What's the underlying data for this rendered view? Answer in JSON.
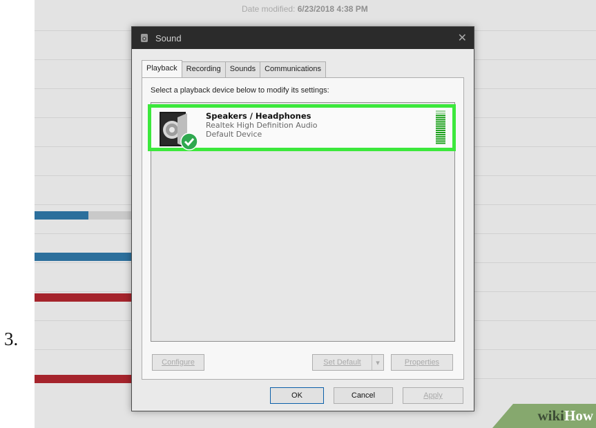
{
  "step": {
    "number": "3."
  },
  "background": {
    "date_label": "Date modified:",
    "date_value": "6/23/2018 4:38 PM"
  },
  "dialog": {
    "title": "Sound",
    "close_glyph": "✕",
    "tabs": [
      {
        "label": "Playback",
        "active": true
      },
      {
        "label": "Recording",
        "active": false
      },
      {
        "label": "Sounds",
        "active": false
      },
      {
        "label": "Communications",
        "active": false
      }
    ],
    "instruction": "Select a playback device below to modify its settings:",
    "devices": [
      {
        "name": "Speakers / Headphones",
        "driver": "Realtek High Definition Audio",
        "status": "Default Device",
        "icon": "speaker-icon",
        "badge_icon": "default-check-icon",
        "selected": true
      }
    ],
    "buttons": {
      "configure": "Configure",
      "set_default": "Set Default",
      "properties": "Properties",
      "ok": "OK",
      "cancel": "Cancel",
      "apply": "Apply"
    }
  },
  "watermark": {
    "wiki": "wiki",
    "how": "How"
  },
  "colors": {
    "highlight": "#3ce83c",
    "titlebar": "#2b2b2b",
    "check_badge": "#2fa84f",
    "vu_meter": "#1aa01a",
    "bar_blue": "#2c6f9c",
    "bar_red": "#a5242c",
    "watermark_green": "#86a86e"
  }
}
